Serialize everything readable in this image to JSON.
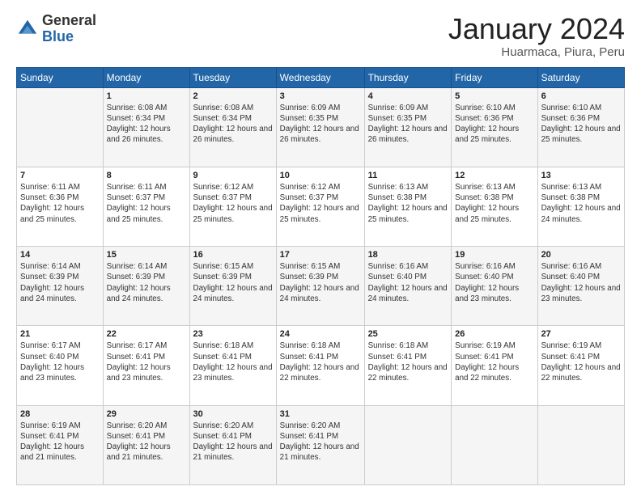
{
  "header": {
    "logo_general": "General",
    "logo_blue": "Blue",
    "title": "January 2024",
    "location": "Huarmaca, Piura, Peru"
  },
  "days_of_week": [
    "Sunday",
    "Monday",
    "Tuesday",
    "Wednesday",
    "Thursday",
    "Friday",
    "Saturday"
  ],
  "weeks": [
    [
      {
        "day": "",
        "sunrise": "",
        "sunset": "",
        "daylight": ""
      },
      {
        "day": "1",
        "sunrise": "6:08 AM",
        "sunset": "6:34 PM",
        "daylight": "12 hours and 26 minutes."
      },
      {
        "day": "2",
        "sunrise": "6:08 AM",
        "sunset": "6:34 PM",
        "daylight": "12 hours and 26 minutes."
      },
      {
        "day": "3",
        "sunrise": "6:09 AM",
        "sunset": "6:35 PM",
        "daylight": "12 hours and 26 minutes."
      },
      {
        "day": "4",
        "sunrise": "6:09 AM",
        "sunset": "6:35 PM",
        "daylight": "12 hours and 26 minutes."
      },
      {
        "day": "5",
        "sunrise": "6:10 AM",
        "sunset": "6:36 PM",
        "daylight": "12 hours and 25 minutes."
      },
      {
        "day": "6",
        "sunrise": "6:10 AM",
        "sunset": "6:36 PM",
        "daylight": "12 hours and 25 minutes."
      }
    ],
    [
      {
        "day": "7",
        "sunrise": "6:11 AM",
        "sunset": "6:36 PM",
        "daylight": "12 hours and 25 minutes."
      },
      {
        "day": "8",
        "sunrise": "6:11 AM",
        "sunset": "6:37 PM",
        "daylight": "12 hours and 25 minutes."
      },
      {
        "day": "9",
        "sunrise": "6:12 AM",
        "sunset": "6:37 PM",
        "daylight": "12 hours and 25 minutes."
      },
      {
        "day": "10",
        "sunrise": "6:12 AM",
        "sunset": "6:37 PM",
        "daylight": "12 hours and 25 minutes."
      },
      {
        "day": "11",
        "sunrise": "6:13 AM",
        "sunset": "6:38 PM",
        "daylight": "12 hours and 25 minutes."
      },
      {
        "day": "12",
        "sunrise": "6:13 AM",
        "sunset": "6:38 PM",
        "daylight": "12 hours and 25 minutes."
      },
      {
        "day": "13",
        "sunrise": "6:13 AM",
        "sunset": "6:38 PM",
        "daylight": "12 hours and 24 minutes."
      }
    ],
    [
      {
        "day": "14",
        "sunrise": "6:14 AM",
        "sunset": "6:39 PM",
        "daylight": "12 hours and 24 minutes."
      },
      {
        "day": "15",
        "sunrise": "6:14 AM",
        "sunset": "6:39 PM",
        "daylight": "12 hours and 24 minutes."
      },
      {
        "day": "16",
        "sunrise": "6:15 AM",
        "sunset": "6:39 PM",
        "daylight": "12 hours and 24 minutes."
      },
      {
        "day": "17",
        "sunrise": "6:15 AM",
        "sunset": "6:39 PM",
        "daylight": "12 hours and 24 minutes."
      },
      {
        "day": "18",
        "sunrise": "6:16 AM",
        "sunset": "6:40 PM",
        "daylight": "12 hours and 24 minutes."
      },
      {
        "day": "19",
        "sunrise": "6:16 AM",
        "sunset": "6:40 PM",
        "daylight": "12 hours and 23 minutes."
      },
      {
        "day": "20",
        "sunrise": "6:16 AM",
        "sunset": "6:40 PM",
        "daylight": "12 hours and 23 minutes."
      }
    ],
    [
      {
        "day": "21",
        "sunrise": "6:17 AM",
        "sunset": "6:40 PM",
        "daylight": "12 hours and 23 minutes."
      },
      {
        "day": "22",
        "sunrise": "6:17 AM",
        "sunset": "6:41 PM",
        "daylight": "12 hours and 23 minutes."
      },
      {
        "day": "23",
        "sunrise": "6:18 AM",
        "sunset": "6:41 PM",
        "daylight": "12 hours and 23 minutes."
      },
      {
        "day": "24",
        "sunrise": "6:18 AM",
        "sunset": "6:41 PM",
        "daylight": "12 hours and 22 minutes."
      },
      {
        "day": "25",
        "sunrise": "6:18 AM",
        "sunset": "6:41 PM",
        "daylight": "12 hours and 22 minutes."
      },
      {
        "day": "26",
        "sunrise": "6:19 AM",
        "sunset": "6:41 PM",
        "daylight": "12 hours and 22 minutes."
      },
      {
        "day": "27",
        "sunrise": "6:19 AM",
        "sunset": "6:41 PM",
        "daylight": "12 hours and 22 minutes."
      }
    ],
    [
      {
        "day": "28",
        "sunrise": "6:19 AM",
        "sunset": "6:41 PM",
        "daylight": "12 hours and 21 minutes."
      },
      {
        "day": "29",
        "sunrise": "6:20 AM",
        "sunset": "6:41 PM",
        "daylight": "12 hours and 21 minutes."
      },
      {
        "day": "30",
        "sunrise": "6:20 AM",
        "sunset": "6:41 PM",
        "daylight": "12 hours and 21 minutes."
      },
      {
        "day": "31",
        "sunrise": "6:20 AM",
        "sunset": "6:41 PM",
        "daylight": "12 hours and 21 minutes."
      },
      {
        "day": "",
        "sunrise": "",
        "sunset": "",
        "daylight": ""
      },
      {
        "day": "",
        "sunrise": "",
        "sunset": "",
        "daylight": ""
      },
      {
        "day": "",
        "sunrise": "",
        "sunset": "",
        "daylight": ""
      }
    ]
  ]
}
